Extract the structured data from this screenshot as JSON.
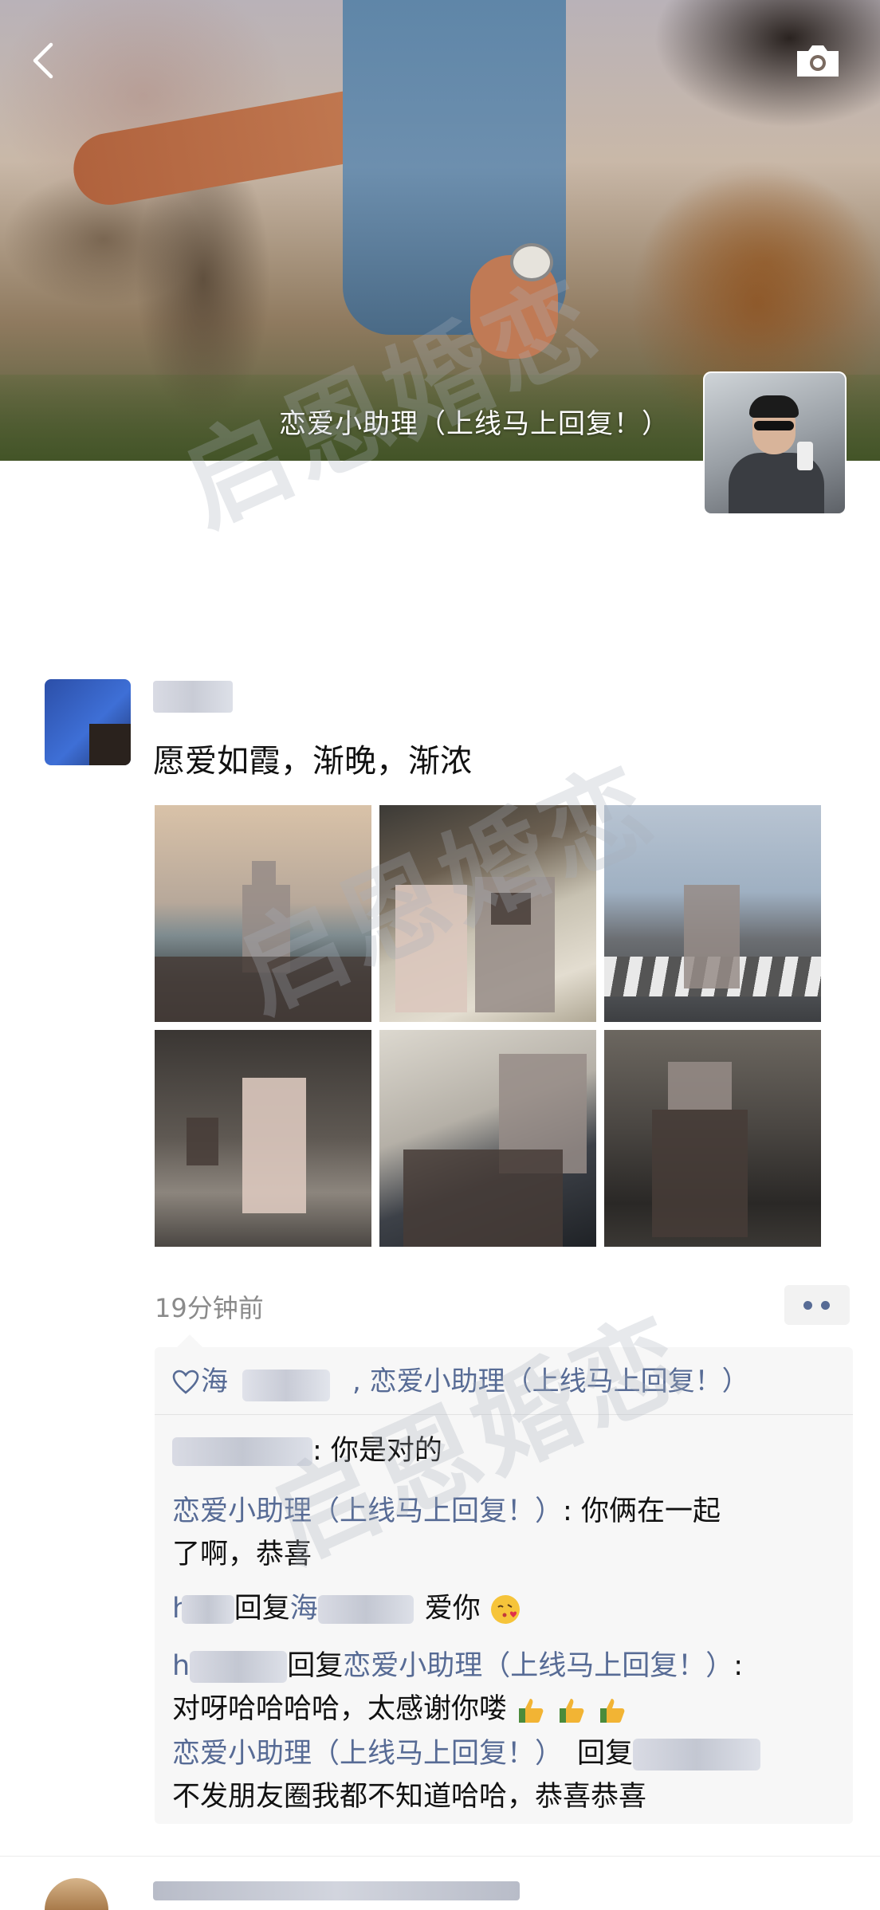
{
  "cover": {
    "profile_name": "恋爱小助理（上线马上回复！）"
  },
  "post": {
    "text": "愿爱如霞，渐晚，渐浓",
    "time": "19分钟前"
  },
  "likes": {
    "first_partial": "海",
    "separator": ",",
    "second": "恋爱小助理（上线马上回复！）"
  },
  "comments": [
    {
      "author_partial": "",
      "sep": ": ",
      "text": "你是对的"
    },
    {
      "author": "恋爱小助理（上线马上回复！）",
      "sep": ": ",
      "text_line1": "你俩在一起",
      "text_line2": "了啊，恭喜"
    },
    {
      "author_partial": "ham",
      "reply_word": "回复",
      "target_partial": "海",
      "text": "爱你",
      "emoji": "kissing-face-heart"
    },
    {
      "author_partial": "h",
      "reply_word": "回复",
      "target": "恋爱小助理（上线马上回复！）",
      "sep": ":",
      "text": "对呀哈哈哈哈，太感谢你喽",
      "emoji": "thumbs-up x3"
    },
    {
      "author": "恋爱小助理（上线马上回复！）",
      "reply_word": "回复",
      "text": "不发朋友圈我都不知道哈哈，恭喜恭喜"
    }
  ],
  "watermark": "启恩婚恋",
  "icons": {
    "back": "chevron-left-icon",
    "camera": "camera-icon",
    "like": "heart-outline-icon",
    "more": "more-dots-icon"
  },
  "colors": {
    "link_blue": "#576b95",
    "time_gray": "#8a8a8a",
    "comment_bg": "#f7f7f7"
  }
}
